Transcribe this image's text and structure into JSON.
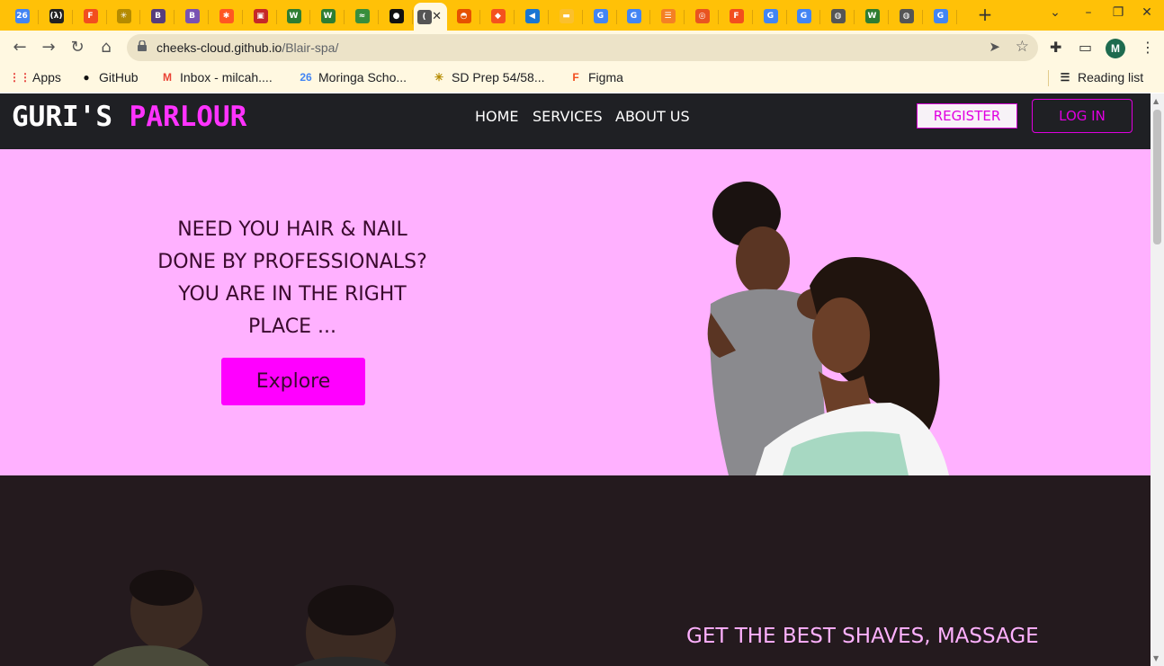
{
  "browser": {
    "tabs": [
      {
        "icon": "calendar-icon",
        "glyph": "26",
        "color": "#4285f4"
      },
      {
        "icon": "codewars-icon",
        "glyph": "(λ)",
        "color": "#222222"
      },
      {
        "icon": "figma-icon",
        "glyph": "F",
        "color": "#f24e1e"
      },
      {
        "icon": "palm-icon",
        "glyph": "✳",
        "color": "#b58b00"
      },
      {
        "icon": "bootstrap-icon",
        "glyph": "B",
        "color": "#563d7c"
      },
      {
        "icon": "bootstrap-icon",
        "glyph": "B",
        "color": "#7952b3"
      },
      {
        "icon": "asterisk-icon",
        "glyph": "✱",
        "color": "#ff5722"
      },
      {
        "icon": "slides-icon",
        "glyph": "▣",
        "color": "#c62828"
      },
      {
        "icon": "w-icon",
        "glyph": "W",
        "color": "#2e7d32"
      },
      {
        "icon": "w-icon",
        "glyph": "W",
        "color": "#2e7d32"
      },
      {
        "icon": "dna-icon",
        "glyph": "≈",
        "color": "#388e3c"
      },
      {
        "icon": "github-icon",
        "glyph": "●",
        "color": "#111111"
      },
      {
        "icon": "page-icon",
        "glyph": "(",
        "color": "#555555"
      },
      {
        "icon": "drawing-icon",
        "glyph": "◓",
        "color": "#e65100"
      },
      {
        "icon": "git-icon",
        "glyph": "◆",
        "color": "#f4511e"
      },
      {
        "icon": "vscode-icon",
        "glyph": "◀",
        "color": "#1976d2"
      },
      {
        "icon": "keep-icon",
        "glyph": "▬",
        "color": "#fbc02d"
      },
      {
        "icon": "google-icon",
        "glyph": "G",
        "color": "#4285f4"
      },
      {
        "icon": "google-icon",
        "glyph": "G",
        "color": "#4285f4"
      },
      {
        "icon": "stack-icon",
        "glyph": "☰",
        "color": "#f48024"
      },
      {
        "icon": "ubuntu-icon",
        "glyph": "◎",
        "color": "#e95420"
      },
      {
        "icon": "figma-icon",
        "glyph": "F",
        "color": "#f24e1e"
      },
      {
        "icon": "google-icon",
        "glyph": "G",
        "color": "#4285f4"
      },
      {
        "icon": "google-icon",
        "glyph": "G",
        "color": "#4285f4"
      },
      {
        "icon": "globe-icon",
        "glyph": "◍",
        "color": "#555555"
      },
      {
        "icon": "w-icon",
        "glyph": "W",
        "color": "#2e7d32"
      },
      {
        "icon": "globe-icon",
        "glyph": "◍",
        "color": "#555555"
      },
      {
        "icon": "google-icon",
        "glyph": "G",
        "color": "#4285f4"
      }
    ],
    "active_tab_index": 12,
    "new_tab": "+",
    "url_host": "cheeks-cloud.github.io",
    "url_path": "/Blair-spa/",
    "avatar_letter": "M",
    "bookmarks": [
      {
        "label": "Apps",
        "icon": "apps-grid-icon",
        "glyph": "⋮⋮",
        "color": "#e53935"
      },
      {
        "label": "GitHub",
        "icon": "github-icon",
        "glyph": "●",
        "color": "#111111"
      },
      {
        "label": "Inbox - milcah....",
        "icon": "gmail-icon",
        "glyph": "M",
        "color": "#ea4335"
      },
      {
        "label": "Moringa Scho...",
        "icon": "calendar-icon",
        "glyph": "26",
        "color": "#4285f4"
      },
      {
        "label": "SD Prep 54/58...",
        "icon": "palm-icon",
        "glyph": "✳",
        "color": "#b58b00"
      },
      {
        "label": "Figma",
        "icon": "figma-icon",
        "glyph": "F",
        "color": "#f24e1e"
      }
    ],
    "reading_list": "Reading list"
  },
  "site": {
    "brand_white": "GURI'S",
    "brand_pink": "PARLOUR",
    "nav": [
      "HOME",
      "SERVICES",
      "ABOUT US"
    ],
    "register": "REGISTER",
    "login": "LOG IN",
    "hero_lines": [
      "NEED YOU HAIR & NAIL",
      "DONE BY PROFESSIONALS?",
      "YOU ARE IN THE RIGHT",
      "PLACE ..."
    ],
    "explore": "Explore",
    "section2_line": "GET THE BEST SHAVES, MASSAGE",
    "colors": {
      "accent": "#ff00ff",
      "hero_bg": "#ffb1ff",
      "nav_bg": "#1f2024",
      "dark_bg": "#241a1e",
      "chrome": "#ffc107"
    }
  }
}
